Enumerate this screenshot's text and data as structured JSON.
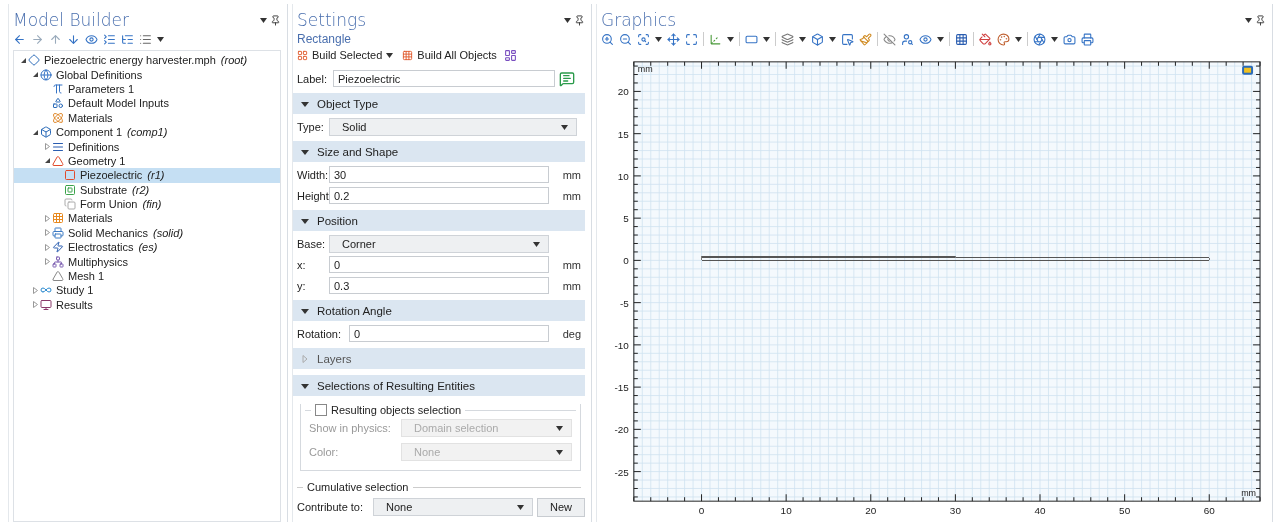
{
  "model_builder": {
    "title": "Model Builder",
    "tree": [
      {
        "label": "Piezoelectric energy harvester.mph",
        "tag": "(root)",
        "expanded": true,
        "selected": false,
        "children": [
          {
            "label": "Global Definitions",
            "expanded": true,
            "selected": false,
            "children": [
              {
                "label": "Parameters 1",
                "selected": false
              },
              {
                "label": "Default Model Inputs",
                "selected": false
              },
              {
                "label": "Materials",
                "selected": false
              }
            ]
          },
          {
            "label": "Component 1",
            "tag": "(comp1)",
            "expanded": true,
            "selected": false,
            "children": [
              {
                "label": "Definitions",
                "expanded": false,
                "selected": false
              },
              {
                "label": "Geometry 1",
                "expanded": true,
                "selected": false,
                "children": [
                  {
                    "label": "Piezoelectric",
                    "tag": "(r1)",
                    "selected": true
                  },
                  {
                    "label": "Substrate",
                    "tag": "(r2)",
                    "selected": false
                  },
                  {
                    "label": "Form Union",
                    "tag": "(fin)",
                    "selected": false
                  }
                ]
              },
              {
                "label": "Materials",
                "expanded": false,
                "selected": false
              },
              {
                "label": "Solid Mechanics",
                "tag": "(solid)",
                "expanded": false,
                "selected": false
              },
              {
                "label": "Electrostatics",
                "tag": "(es)",
                "expanded": false,
                "selected": false
              },
              {
                "label": "Multiphysics",
                "expanded": false,
                "selected": false
              },
              {
                "label": "Mesh 1",
                "selected": false
              }
            ]
          },
          {
            "label": "Study 1",
            "expanded": false,
            "selected": false
          },
          {
            "label": "Results",
            "expanded": false,
            "selected": false
          }
        ]
      }
    ]
  },
  "settings": {
    "title": "Settings",
    "subtitle": "Rectangle",
    "toolbar": [
      {
        "label": "Build Selected",
        "kind": "split"
      },
      {
        "label": "Build All Objects",
        "kind": "button"
      },
      {
        "kind": "icon"
      }
    ],
    "label_field": {
      "label": "Label:",
      "value": "Piezoelectric"
    },
    "sections": [
      {
        "title": "Object Type",
        "expanded": true,
        "disabled": false,
        "rows": [
          {
            "kind": "select",
            "label": "Type:",
            "value": "Solid"
          }
        ]
      },
      {
        "title": "Size and Shape",
        "expanded": true,
        "disabled": false,
        "rows": [
          {
            "kind": "input",
            "label": "Width:",
            "value": "30",
            "unit": "mm"
          },
          {
            "kind": "input",
            "label": "Height:",
            "value": "0.2",
            "unit": "mm"
          }
        ]
      },
      {
        "title": "Position",
        "expanded": true,
        "disabled": false,
        "rows": [
          {
            "kind": "select",
            "label": "Base:",
            "value": "Corner"
          },
          {
            "kind": "input",
            "label": "x:",
            "value": "0",
            "unit": "mm"
          },
          {
            "kind": "input",
            "label": "y:",
            "value": "0.3",
            "unit": "mm"
          }
        ]
      },
      {
        "title": "Rotation Angle",
        "expanded": true,
        "disabled": false,
        "rows": [
          {
            "kind": "input",
            "label": "Rotation:",
            "value": "0",
            "unit": "deg"
          }
        ]
      },
      {
        "title": "Layers",
        "expanded": false,
        "disabled": true
      },
      {
        "title": "Selections of Resulting Entities",
        "expanded": true,
        "disabled": false,
        "rows": [
          {
            "kind": "group",
            "label": "Resulting objects selection",
            "checked": false,
            "rows": [
              {
                "label": "Show in physics:",
                "value": "Domain selection",
                "disabled": true
              },
              {
                "label": "Color:",
                "value": "None",
                "disabled": true
              }
            ]
          },
          {
            "kind": "cumulative",
            "label": "Cumulative selection",
            "field_label": "Contribute to:",
            "value": "None",
            "button": "New"
          }
        ]
      }
    ]
  },
  "graphics": {
    "title": "Graphics",
    "chart_data": {
      "type": "line",
      "xlabel": "mm",
      "ylabel": "mm",
      "xlim": [
        -8,
        66
      ],
      "ylim": [
        -28.5,
        23.5
      ],
      "xticks": [
        0,
        10,
        20,
        30,
        40,
        50,
        60
      ],
      "yticks": [
        -25,
        -20,
        -15,
        -10,
        -5,
        0,
        5,
        10,
        15,
        20
      ],
      "grid": true,
      "x": [
        0,
        30,
        60
      ],
      "series": [
        {
          "color": "#555555",
          "values": [
            0,
            0,
            0
          ]
        },
        {
          "color": "#555555",
          "values": [
            0.3,
            0.3,
            0.3
          ]
        },
        {
          "color": "#555555",
          "values": [
            0.5,
            0.5,
            null
          ]
        }
      ]
    }
  }
}
